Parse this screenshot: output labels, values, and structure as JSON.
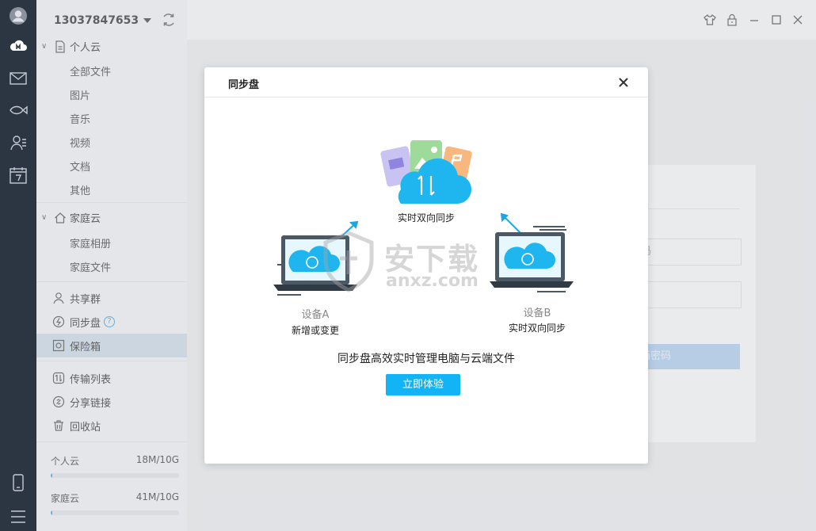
{
  "account": {
    "phone": "13037847653"
  },
  "sidebar": {
    "personal_cloud": {
      "label": "个人云",
      "items": [
        "全部文件",
        "图片",
        "音乐",
        "视频",
        "文档",
        "其他"
      ]
    },
    "family_cloud": {
      "label": "家庭云",
      "items": [
        "家庭相册",
        "家庭文件"
      ]
    },
    "tools": [
      {
        "label": "共享群",
        "icon": "user-icon"
      },
      {
        "label": "同步盘",
        "icon": "sync-drive-icon",
        "help": "?"
      },
      {
        "label": "保险箱",
        "icon": "safe-icon",
        "active": true
      }
    ],
    "extras": [
      {
        "label": "传输列表",
        "icon": "transfer-icon"
      },
      {
        "label": "分享链接",
        "icon": "share-link-icon"
      },
      {
        "label": "回收站",
        "icon": "trash-icon"
      }
    ],
    "storage": [
      {
        "label": "个人云",
        "usage": "18M/10G",
        "fraction": 0.0018
      },
      {
        "label": "家庭云",
        "usage": "41M/10G",
        "fraction": 0.004
      }
    ]
  },
  "background_panel": {
    "input1_partial": "码",
    "button_partial": "箱密码"
  },
  "modal": {
    "title": "同步盘",
    "cloud_caption": "实时双向同步",
    "device_a": {
      "name": "设备A",
      "caption": "新增或变更"
    },
    "device_b": {
      "name": "设备B",
      "caption": "实时双向同步"
    },
    "description": "同步盘高效实时管理电脑与云端文件",
    "cta": "立即体验"
  },
  "watermark": {
    "text": "安下载",
    "sub": "anxz.com"
  },
  "colors": {
    "accent": "#12b4f5",
    "rail": "#2c3642",
    "active_row": "#c9d8e6",
    "cloud": "#1fb6f0"
  }
}
